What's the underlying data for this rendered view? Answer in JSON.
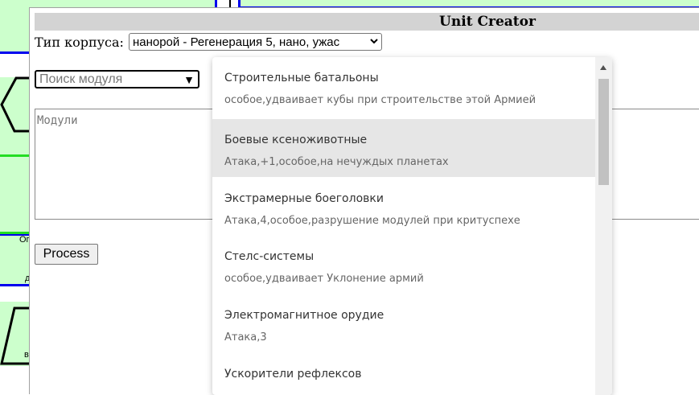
{
  "background": {
    "label_1": "Ог",
    "label_2": "д",
    "label_3": "в"
  },
  "dialog": {
    "title": "Unit Creator",
    "hull_label": "Тип корпуса:",
    "hull_value": "нанорой - Регенерация 5, нано, ужас",
    "search_placeholder": "Поиск модуля",
    "modules_placeholder": "Модули",
    "process_label": "Process"
  },
  "dropdown": {
    "options": [
      {
        "name": "Строительные батальоны",
        "desc": "особое,удваивает кубы при строительстве этой Армией"
      },
      {
        "name": "Боевые ксеноживотные",
        "desc": "Атака,+1,особое,на нечуждых планетах"
      },
      {
        "name": "Экстрамерные боеголовки",
        "desc": "Атака,4,особое,разрушение модулей при критуспехе"
      },
      {
        "name": "Стелс-системы",
        "desc": "особое,удваивает Уклонение армий"
      },
      {
        "name": "Электромагнитное орудие",
        "desc": "Атака,3"
      },
      {
        "name": "Ускорители рефлексов",
        "desc": ""
      }
    ],
    "highlighted_index": 1
  },
  "colors": {
    "diagram_fill": "#ccffcc",
    "diagram_border": "#0000ee",
    "connector_green": "#22dd22",
    "title_bar": "#d3d3d3",
    "highlight": "#e6e6e6"
  }
}
